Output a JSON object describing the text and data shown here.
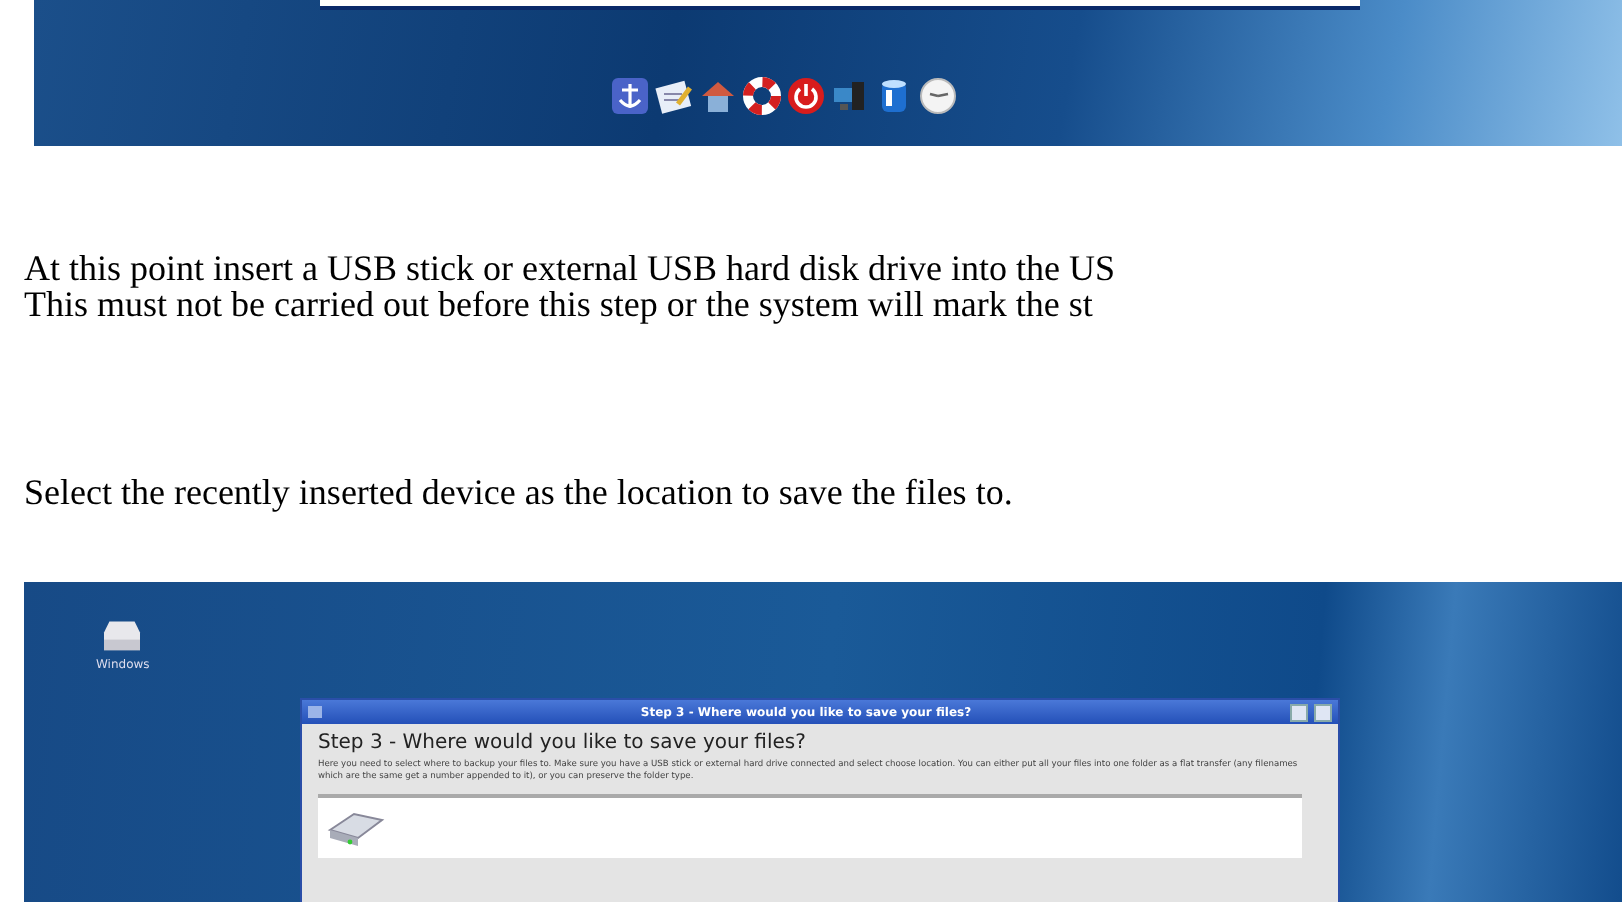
{
  "paragraphs": [
    {
      "lines": [
        "At this point insert a USB stick or external USB hard disk drive into the US",
        "This must not be carried out before this step or the system will mark the st"
      ]
    },
    {
      "lines": [
        "Select the recently inserted device as the location to save the files to."
      ]
    }
  ],
  "screenshot": {
    "desktop_icon": {
      "label": "Windows"
    },
    "dialog": {
      "title": "Step 3 - Where would you like to save your files?",
      "heading": "Step 3 - Where would you like to save your files?",
      "description": "Here you need to select where to backup your files to. Make sure you have a USB stick or external hard drive connected and select choose location. You can either put all your files into one folder as a flat transfer (any filenames which are the same get a number appended to it), or you can preserve the folder type."
    }
  }
}
